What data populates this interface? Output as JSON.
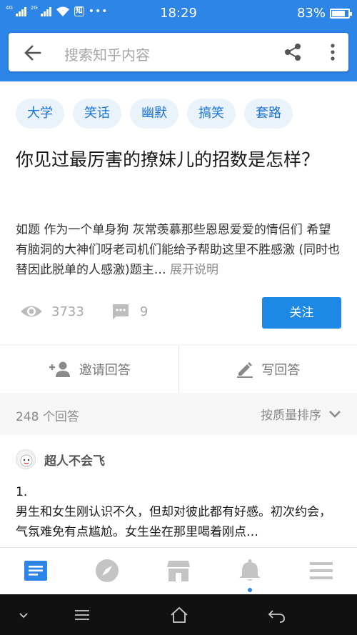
{
  "status_bar": {
    "network_1": "4G",
    "network_2": "2G",
    "app_badge": "知",
    "more": "•••",
    "time": "18:29",
    "battery": "83%",
    "battery_level": 0.83
  },
  "search": {
    "placeholder": "搜索知乎内容"
  },
  "question": {
    "tags": [
      "大学",
      "笑话",
      "幽默",
      "搞笑",
      "套路"
    ],
    "title": "你见过最厉害的撩妹儿的招数是怎样？",
    "description": "如题 作为一个单身狗 灰常羡慕那些恩恩爱爱的情侣们 希望有脑洞的大神们呀老司机们能给予帮助这里不胜感激 (同时也替因此脱单的人感激)题主…",
    "expand_label": "展开说明",
    "views": "3733",
    "comments": "9",
    "follow_label": "关注"
  },
  "actions": {
    "invite_label": "邀请回答",
    "write_label": "写回答"
  },
  "answers": {
    "count_label": "248 个回答",
    "sort_label": "按质量排序"
  },
  "answer": {
    "author": "超人不会飞",
    "text_line1": "1.",
    "text_line2": "男生和女生刚认识不久，但却对彼此都有好感。初次约会，气氛难免有点尴尬。女生坐在那里喝着刚点…"
  },
  "tabbar": {
    "icons": [
      "feed-icon",
      "explore-icon",
      "market-icon",
      "notification-icon",
      "menu-icon"
    ]
  },
  "colors": {
    "brand": "#2d85e8",
    "follow_button": "#1e88e5",
    "tag_text": "#1a73d9",
    "tag_bg": "#eaf2fc"
  }
}
